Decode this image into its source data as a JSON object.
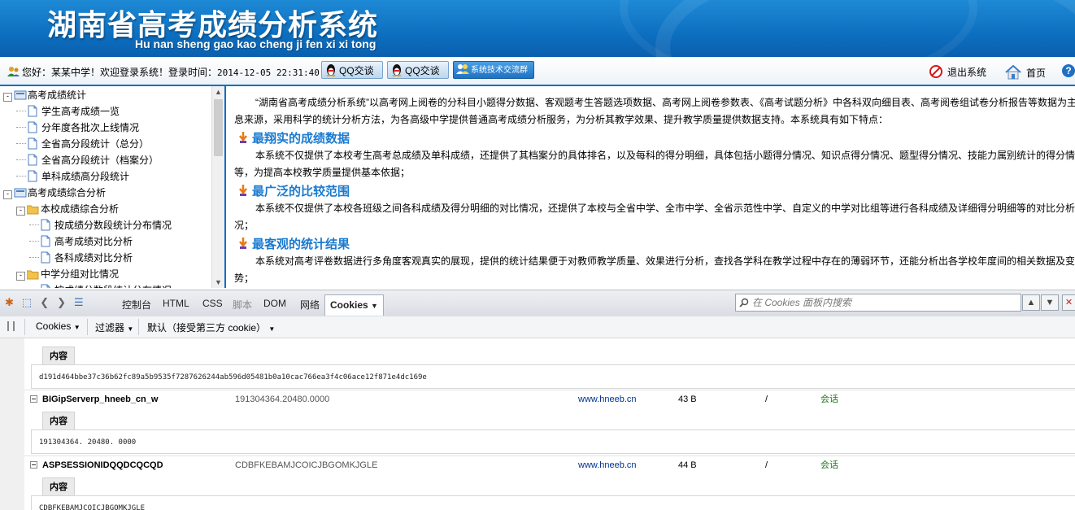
{
  "banner": {
    "title": "湖南省高考成绩分析系统",
    "subtitle": "Hu nan sheng gao kao cheng ji fen xi xi tong"
  },
  "topbar": {
    "welcome": "您好：某某中学！欢迎登录系统！登录时间：",
    "login_time": "2014-12-05 22:31:40",
    "qq_label_1": "QQ交谈",
    "qq_label_2": "QQ交谈",
    "tech_label": "系统技术交流群",
    "logout": "退出系统",
    "home": "首页",
    "help": "?"
  },
  "tree": {
    "items": [
      {
        "label": "高考成绩统计",
        "level": 0,
        "type": "folder"
      },
      {
        "label": "学生高考成绩一览",
        "level": 1,
        "type": "page"
      },
      {
        "label": "分年度各批次上线情况",
        "level": 1,
        "type": "page"
      },
      {
        "label": "全省高分段统计（总分）",
        "level": 1,
        "type": "page"
      },
      {
        "label": "全省高分段统计（档案分）",
        "level": 1,
        "type": "page"
      },
      {
        "label": "单科成绩高分段统计",
        "level": 1,
        "type": "page"
      },
      {
        "label": "高考成绩综合分析",
        "level": 0,
        "type": "folder"
      },
      {
        "label": "本校成绩综合分析",
        "level": 1,
        "type": "folder"
      },
      {
        "label": "按成绩分数段统计分布情况",
        "level": 2,
        "type": "page"
      },
      {
        "label": "高考成绩对比分析",
        "level": 2,
        "type": "page"
      },
      {
        "label": "各科成绩对比分析",
        "level": 2,
        "type": "page"
      },
      {
        "label": "中学分组对比情况",
        "level": 1,
        "type": "folder"
      },
      {
        "label": "按成绩分数段统计分布情况",
        "level": 2,
        "type": "page"
      }
    ]
  },
  "content": {
    "intro": "“湖南省高考成绩分析系统”以高考网上阅卷的分科目小题得分数据、客观题考生答题选项数据、高考网上阅卷参数表、《高考试题分析》中各科双向细目表、高考阅卷组试卷分析报告等数据为主要信息来源，采用科学的统计分析方法，为各高级中学提供普通高考成绩分析服务，为分析其教学效果、提升教学质量提供数据支持。本系统具有如下特点：",
    "features": [
      {
        "title": "最翔实的成绩数据",
        "text": "本系统不仅提供了本校考生高考总成绩及单科成绩，还提供了其档案分的具体排名，以及每科的得分明细，具体包括小题得分情况、知识点得分情况、题型得分情况、技能力属别统计的得分情况等，为提高本校教学质量提供基本依据；"
      },
      {
        "title": "最广泛的比较范围",
        "text": "本系统不仅提供了本校各班级之间各科成绩及得分明细的对比情况，还提供了本校与全省中学、全市中学、全省示范性中学、自定义的中学对比组等进行各科成绩及详细得分明细等的对比分析情况；"
      },
      {
        "title": "最客观的统计结果",
        "text": "本系统对高考评卷数据进行多角度客观真实的展现，提供的统计结果便于对教师教学质量、效果进行分析，查找各学科在教学过程中存在的薄弱环节，还能分析出各学校年度间的相关数据及变化趋势；"
      }
    ]
  },
  "firebug": {
    "tabs": [
      "控制台",
      "HTML",
      "CSS",
      "脚本",
      "DOM",
      "网络",
      "Cookies"
    ],
    "active_tab": "Cookies",
    "search_placeholder": "在 Cookies 面板内搜索",
    "sub_cookies": "Cookies",
    "sub_filter": "过滤器",
    "sub_default": "默认（接受第三方 cookie）"
  },
  "cookies": {
    "detail_tab_label": "内容",
    "first_value": "d191d464bbe37c36b62fc89a5b9535f7287626244ab596d05481b0a10cac766ea3f4c06ace12f871e4dc169e",
    "rows": [
      {
        "name": "BIGipServerp_hneeb_cn_w",
        "value": "191304364.20480.0000",
        "domain": "www.hneeb.cn",
        "size": "43 B",
        "path": "/",
        "expires": "会话",
        "detail": "191304364. 20480. 0000"
      },
      {
        "name": "ASPSESSIONIDQQDCQCQD",
        "value": "CDBFKEBAMJCOICJBGOMKJGLE",
        "domain": "www.hneeb.cn",
        "size": "44 B",
        "path": "/",
        "expires": "会话",
        "detail": "CDBFKEBAMJCOICJBGOMKJGLE"
      }
    ]
  },
  "colors": {
    "banner": "#0d6fc0",
    "feature_title": "#1a7ad0",
    "domain_link": "#00308f",
    "session_green": "#1a7a1a"
  }
}
